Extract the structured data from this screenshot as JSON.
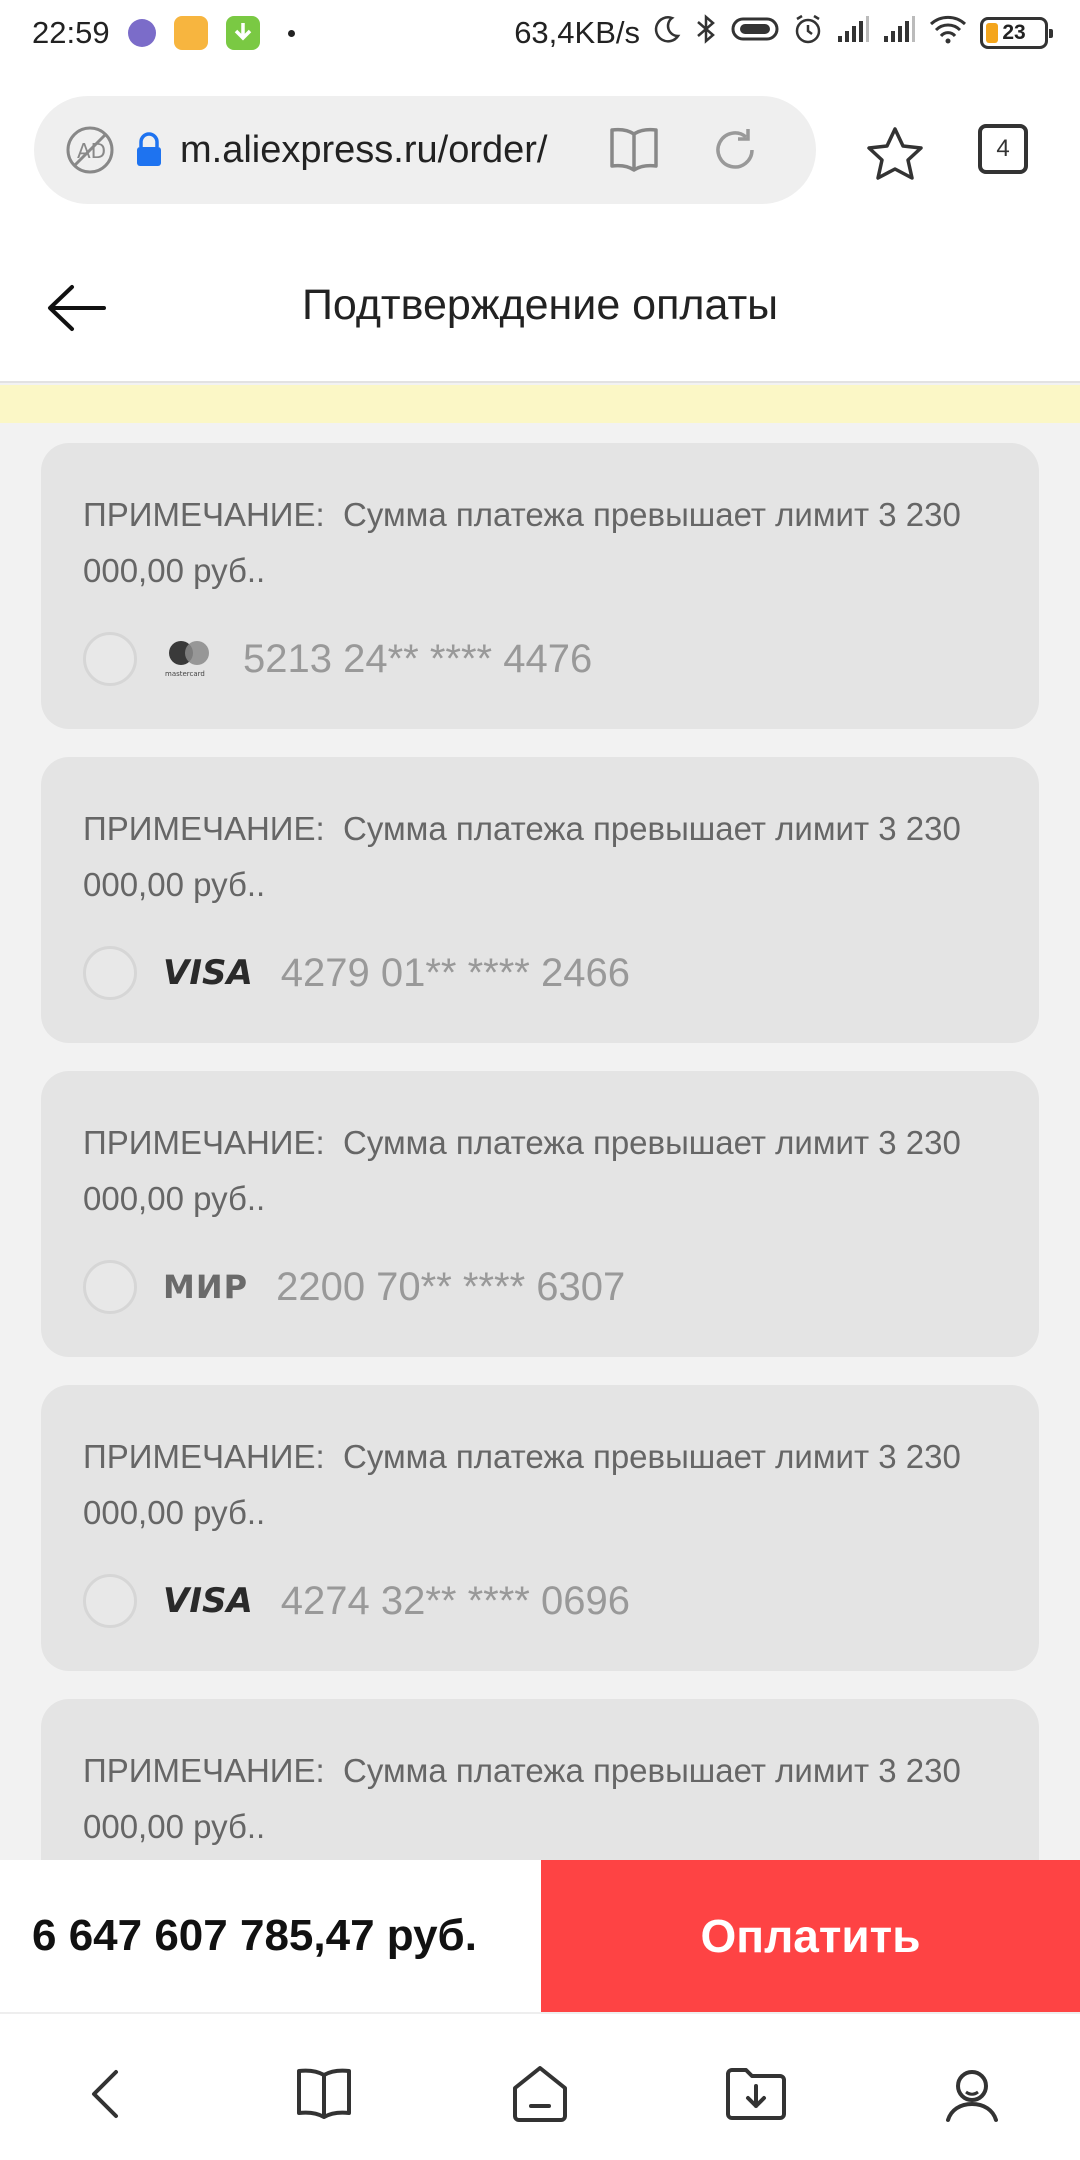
{
  "status_bar": {
    "time": "22:59",
    "network_speed": "63,4KB/s",
    "battery": "23"
  },
  "browser": {
    "url": "m.aliexpress.ru/order/",
    "tab_count": "4"
  },
  "header": {
    "title": "Подтверждение оплаты"
  },
  "cards": [
    {
      "note_label": "ПРИМЕЧАНИЕ:",
      "note_text": "Сумма платежа превышает лимит 3 230 000,00 руб..",
      "brand": "mastercard",
      "brand_label": "mastercard",
      "number": "5213 24** **** 4476"
    },
    {
      "note_label": "ПРИМЕЧАНИЕ:",
      "note_text": "Сумма платежа превышает лимит 3 230 000,00 руб..",
      "brand": "visa",
      "brand_label": "VISA",
      "number": "4279 01** **** 2466"
    },
    {
      "note_label": "ПРИМЕЧАНИЕ:",
      "note_text": "Сумма платежа превышает лимит 3 230 000,00 руб..",
      "brand": "mir",
      "brand_label": "МИР",
      "number": "2200 70** **** 6307"
    },
    {
      "note_label": "ПРИМЕЧАНИЕ:",
      "note_text": "Сумма платежа превышает лимит 3 230 000,00 руб..",
      "brand": "visa",
      "brand_label": "VISA",
      "number": "4274 32** **** 0696"
    },
    {
      "note_label": "ПРИМЕЧАНИЕ:",
      "note_text": "Сумма платежа превышает лимит 3 230 000,00 руб..",
      "brand": "",
      "brand_label": "",
      "number": ""
    }
  ],
  "footer": {
    "total": "6 647 607 785,47 руб.",
    "pay_label": "Оплатить"
  },
  "colors": {
    "pay_button": "#fe4344",
    "notice_strip": "#fbf7c6",
    "card_bg": "#e4e4e4"
  },
  "icons": {
    "back": "arrow-left-icon",
    "star": "star-icon",
    "reader": "book-icon",
    "reload": "reload-icon",
    "adblock": "ad-block-icon",
    "lock": "lock-icon"
  }
}
